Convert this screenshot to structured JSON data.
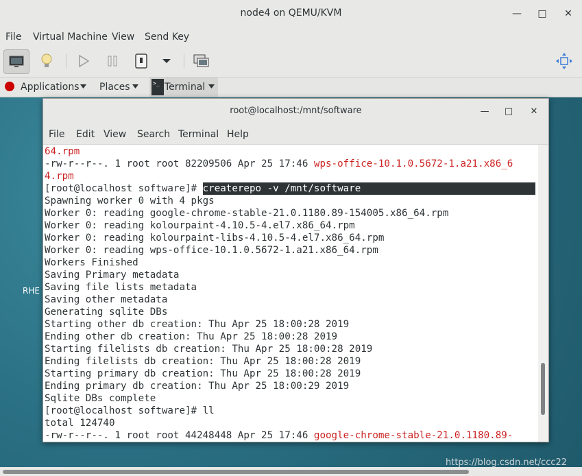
{
  "window": {
    "title": "node4 on QEMU/KVM",
    "controls": [
      "minimize",
      "maximize",
      "close"
    ]
  },
  "menubar": [
    "File",
    "Virtual Machine",
    "View",
    "Send Key"
  ],
  "toolbar": {
    "items": [
      "show-console",
      "show-details",
      "run",
      "pause",
      "shutdown",
      "shutdown-menu",
      "snapshots",
      "fullscreen"
    ]
  },
  "guest_topbar": {
    "applications": "Applications",
    "places": "Places",
    "terminal": "Terminal"
  },
  "desktop": {
    "label": "RHE"
  },
  "terminal": {
    "title": "root@localhost:/mnt/software",
    "menu": [
      "File",
      "Edit",
      "View",
      "Search",
      "Terminal",
      "Help"
    ],
    "lines": [
      {
        "segments": [
          {
            "text": "64.rpm",
            "color": "red"
          }
        ]
      },
      {
        "segments": [
          {
            "text": "-rw-r--r--. 1 root root 82209506 Apr 25 17:46 "
          },
          {
            "text": "wps-office-10.1.0.5672-1.a21.x86_6",
            "color": "red"
          }
        ]
      },
      {
        "segments": [
          {
            "text": "4.rpm",
            "color": "red"
          }
        ]
      },
      {
        "segments": [
          {
            "text": "[root@localhost software]# "
          },
          {
            "text": "createrepo -v /mnt/software",
            "highlight": true
          }
        ]
      },
      {
        "segments": [
          {
            "text": "Spawning worker 0 with 4 pkgs"
          }
        ]
      },
      {
        "segments": [
          {
            "text": "Worker 0: reading google-chrome-stable-21.0.1180.89-154005.x86_64.rpm"
          }
        ]
      },
      {
        "segments": [
          {
            "text": "Worker 0: reading kolourpaint-4.10.5-4.el7.x86_64.rpm"
          }
        ]
      },
      {
        "segments": [
          {
            "text": "Worker 0: reading kolourpaint-libs-4.10.5-4.el7.x86_64.rpm"
          }
        ]
      },
      {
        "segments": [
          {
            "text": "Worker 0: reading wps-office-10.1.0.5672-1.a21.x86_64.rpm"
          }
        ]
      },
      {
        "segments": [
          {
            "text": "Workers Finished"
          }
        ]
      },
      {
        "segments": [
          {
            "text": "Saving Primary metadata"
          }
        ]
      },
      {
        "segments": [
          {
            "text": "Saving file lists metadata"
          }
        ]
      },
      {
        "segments": [
          {
            "text": "Saving other metadata"
          }
        ]
      },
      {
        "segments": [
          {
            "text": "Generating sqlite DBs"
          }
        ]
      },
      {
        "segments": [
          {
            "text": "Starting other db creation: Thu Apr 25 18:00:28 2019"
          }
        ]
      },
      {
        "segments": [
          {
            "text": "Ending other db creation: Thu Apr 25 18:00:28 2019"
          }
        ]
      },
      {
        "segments": [
          {
            "text": "Starting filelists db creation: Thu Apr 25 18:00:28 2019"
          }
        ]
      },
      {
        "segments": [
          {
            "text": "Ending filelists db creation: Thu Apr 25 18:00:28 2019"
          }
        ]
      },
      {
        "segments": [
          {
            "text": "Starting primary db creation: Thu Apr 25 18:00:28 2019"
          }
        ]
      },
      {
        "segments": [
          {
            "text": "Ending primary db creation: Thu Apr 25 18:00:29 2019"
          }
        ]
      },
      {
        "segments": [
          {
            "text": "Sqlite DBs complete"
          }
        ]
      },
      {
        "segments": [
          {
            "text": "[root@localhost software]# ll"
          }
        ]
      },
      {
        "segments": [
          {
            "text": "total 124740"
          }
        ]
      },
      {
        "segments": [
          {
            "text": "-rw-r--r--. 1 root root 44248448 Apr 25 17:46 "
          },
          {
            "text": "google-chrome-stable-21.0.1180.89-",
            "color": "red"
          }
        ]
      }
    ]
  },
  "watermark": "https://blog.csdn.net/ccc22",
  "colors": {
    "desktop": "#2a6f83",
    "file_red": "#cc2222",
    "selection_bg": "#2e3436"
  }
}
